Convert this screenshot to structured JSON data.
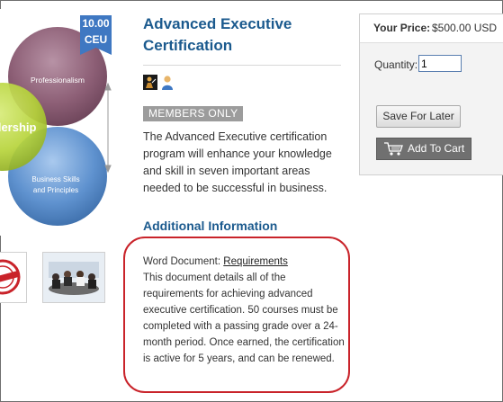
{
  "badge": {
    "number": "10.00",
    "unit": "CEU"
  },
  "diagram": {
    "top_circle": "Professionalism",
    "left_circle": "dership",
    "bottom_circle_line1": "Business Skills",
    "bottom_circle_line2": "and Principles"
  },
  "product": {
    "title": "Advanced Executive Certification",
    "members_badge": "MEMBERS ONLY",
    "description": "The Advanced Executive certification program will enhance your knowledge and skill in seven important areas needed to be successful in business."
  },
  "additional": {
    "heading": "Additional Information",
    "doc_label": "Word Document:",
    "doc_link": "Requirements",
    "doc_text": "This document details all of the requirements for achieving advanced executive certification. 50 courses must be completed with a passing grade over a 24-month period. Once earned, the certification is active for 5 years, and can be renewed."
  },
  "purchase": {
    "price_label": "Your Price:",
    "price_value": "$500.00 USD",
    "quantity_label": "Quantity:",
    "quantity_value": "1",
    "save_label": "Save For Later",
    "cart_label": "Add To Cart"
  },
  "colors": {
    "heading_blue": "#1b5a8e",
    "highlight_red": "#c9232a",
    "badge_blue": "#3f78c2",
    "panel_bg": "#f3f3f3"
  },
  "icons": [
    "presenter-icon",
    "user-icon",
    "shopping-cart-icon"
  ]
}
